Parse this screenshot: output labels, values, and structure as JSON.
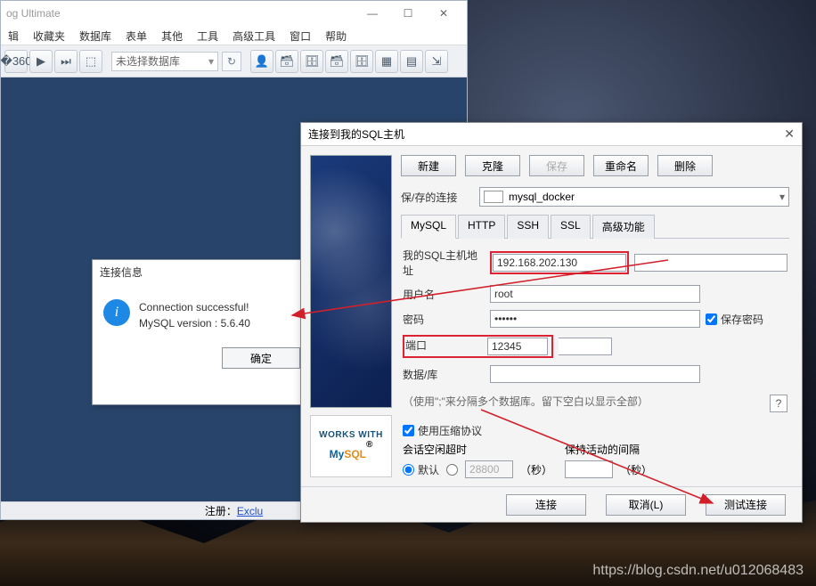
{
  "main_window": {
    "title": "og Ultimate",
    "menu": [
      "辑",
      "收藏夹",
      "数据库",
      "表单",
      "其他",
      "工具",
      "高级工具",
      "窗口",
      "帮助"
    ],
    "db_selector": "未选择数据库",
    "status_prefix": "注册：",
    "status_link": "Exclu"
  },
  "info_dialog": {
    "title": "连接信息",
    "line1": "Connection successful!",
    "line2": "MySQL version : 5.6.40",
    "ok": "确定"
  },
  "conn_dialog": {
    "title": "连接到我的SQL主机",
    "buttons": {
      "new": "新建",
      "clone": "克隆",
      "save": "保存",
      "rename": "重命名",
      "delete": "删除"
    },
    "saved_label": "保/存的连接",
    "saved_value": "mysql_docker",
    "tabs": [
      "MySQL",
      "HTTP",
      "SSH",
      "SSL",
      "高级功能"
    ],
    "fields": {
      "host_label": "我的SQL主机地址",
      "host": "192.168.202.130",
      "user_label": "用户名",
      "user": "root",
      "pwd_label": "密码",
      "pwd": "••••••",
      "save_pwd": "保存密码",
      "port_label": "端口",
      "port": "12345",
      "db_label": "数据/库",
      "db": ""
    },
    "db_hint": "（使用\";\"来分隔多个数据库。留下空白以显示全部）",
    "compress": "使用压缩协议",
    "idle": {
      "title": "会话空闲超时",
      "default": "默认",
      "custom_value": "28800",
      "sec": "（秒）"
    },
    "keepalive": {
      "title": "保持活动的间隔",
      "sec": "（秒）"
    },
    "footer": {
      "connect": "连接",
      "cancel": "取消(L)",
      "test": "测试连接"
    },
    "badge": {
      "works": "WORKS WITH",
      "mysql_my": "My",
      "mysql_sql": "SQL",
      "dot": "®"
    }
  },
  "watermark": "https://blog.csdn.net/u012068483"
}
